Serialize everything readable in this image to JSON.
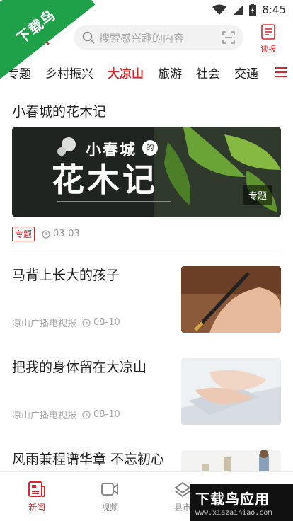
{
  "status_bar": {
    "time": "8:45"
  },
  "watermark": {
    "corner_text": "下载鸟",
    "bottom_text": "下载鸟应用",
    "bottom_url": "www.xiazainiao.com"
  },
  "header": {
    "logo_text": "报",
    "search_placeholder": "搜索感兴趣的内容",
    "read_label": "读报"
  },
  "tabs": [
    {
      "label": "专题"
    },
    {
      "label": "乡村振兴"
    },
    {
      "label": "大凉山",
      "active": true
    },
    {
      "label": "旅游"
    },
    {
      "label": "社会"
    },
    {
      "label": "交通"
    }
  ],
  "featured": {
    "title": "小春城的花木记",
    "image_small_text": "小春城",
    "image_dot_text": "的",
    "image_big_text": "花木记",
    "badge": "专题",
    "tag": "专题",
    "date": "03-03"
  },
  "articles": [
    {
      "title": "马背上长大的孩子",
      "source": "凉山广播电视报",
      "date": "08-10"
    },
    {
      "title": "把我的身体留在大凉山",
      "source": "凉山广播电视报",
      "date": "08-10"
    },
    {
      "title": "风雨兼程谱华章 不忘初心再启航——凉山雅因",
      "source": "",
      "date": ""
    }
  ],
  "bottom_nav": [
    {
      "label": "新闻",
      "icon": "news-icon",
      "active": true
    },
    {
      "label": "视频",
      "icon": "video-icon"
    },
    {
      "label": "县市",
      "icon": "county-icon"
    }
  ],
  "colors": {
    "accent": "#d8262b",
    "watermark_green": "#1fa14a"
  }
}
